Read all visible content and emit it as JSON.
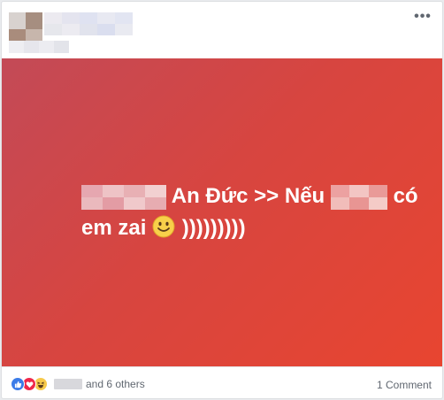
{
  "post": {
    "text_part1": "An Đức >> Nếu",
    "text_part2": "có",
    "text_line2": "em zai",
    "text_parens": ")))))))))",
    "background_colors": [
      "#c34a57",
      "#d74540",
      "#e84530"
    ]
  },
  "footer": {
    "reactions": [
      "like-icon",
      "love-icon",
      "haha-icon"
    ],
    "others_text": "and 6 others",
    "comments_text": "1 Comment"
  },
  "header": {
    "more_icon": "•••"
  }
}
